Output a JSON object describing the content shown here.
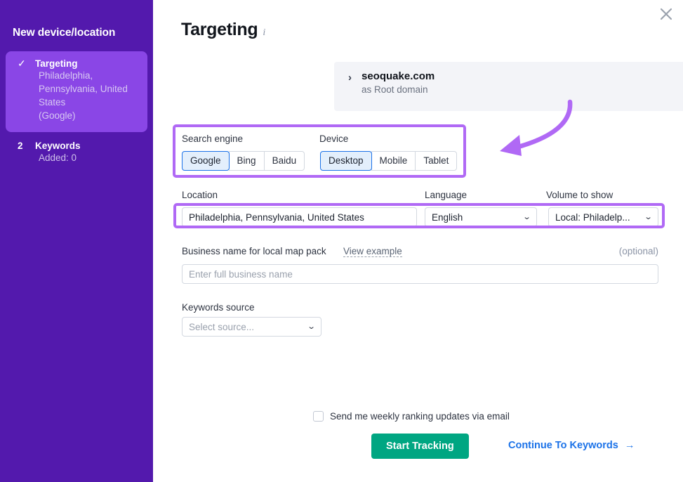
{
  "sidebar": {
    "title": "New device/location",
    "steps": [
      {
        "marker": "check",
        "label": "Targeting",
        "sub_lines": [
          "Philadelphia, Pennsylvania, United States",
          "(Google)"
        ],
        "active": true
      },
      {
        "marker": "2",
        "label": "Keywords",
        "sub_lines": [
          "Added: 0"
        ],
        "active": false
      }
    ]
  },
  "main": {
    "close_icon": "close-icon",
    "title": "Targeting",
    "info_icon": "i",
    "domain_card": {
      "chevron": "›",
      "name": "seoquake.com",
      "subtitle": "as Root domain"
    },
    "search_engine": {
      "label": "Search engine",
      "options": [
        "Google",
        "Bing",
        "Baidu"
      ],
      "selected": "Google"
    },
    "device": {
      "label": "Device",
      "options": [
        "Desktop",
        "Mobile",
        "Tablet"
      ],
      "selected": "Desktop"
    },
    "location": {
      "label": "Location",
      "value": "Philadelphia, Pennsylvania, United States"
    },
    "language": {
      "label": "Language",
      "value": "English",
      "chevron": "⌄"
    },
    "volume": {
      "label": "Volume to show",
      "value": "Local: Philadelp...",
      "chevron": "⌄"
    },
    "business_name": {
      "label": "Business name for local map pack",
      "view_example": "View example",
      "optional": "(optional)",
      "placeholder": "Enter full business name",
      "value": ""
    },
    "keywords_source": {
      "label": "Keywords source",
      "value": "Select source...",
      "chevron": "⌄"
    },
    "weekly_email": {
      "label": "Send me weekly ranking updates via email",
      "checked": false
    },
    "start_button": "Start Tracking",
    "continue_link": "Continue To Keywords",
    "continue_arrow": "→"
  },
  "colors": {
    "sidebar_bg": "#5319ad",
    "sidebar_active": "#8a46e6",
    "accent_blue": "#1b72e8",
    "green_button": "#00a682",
    "highlight_purple": "#b069f5",
    "card_bg": "#f3f4f8"
  }
}
